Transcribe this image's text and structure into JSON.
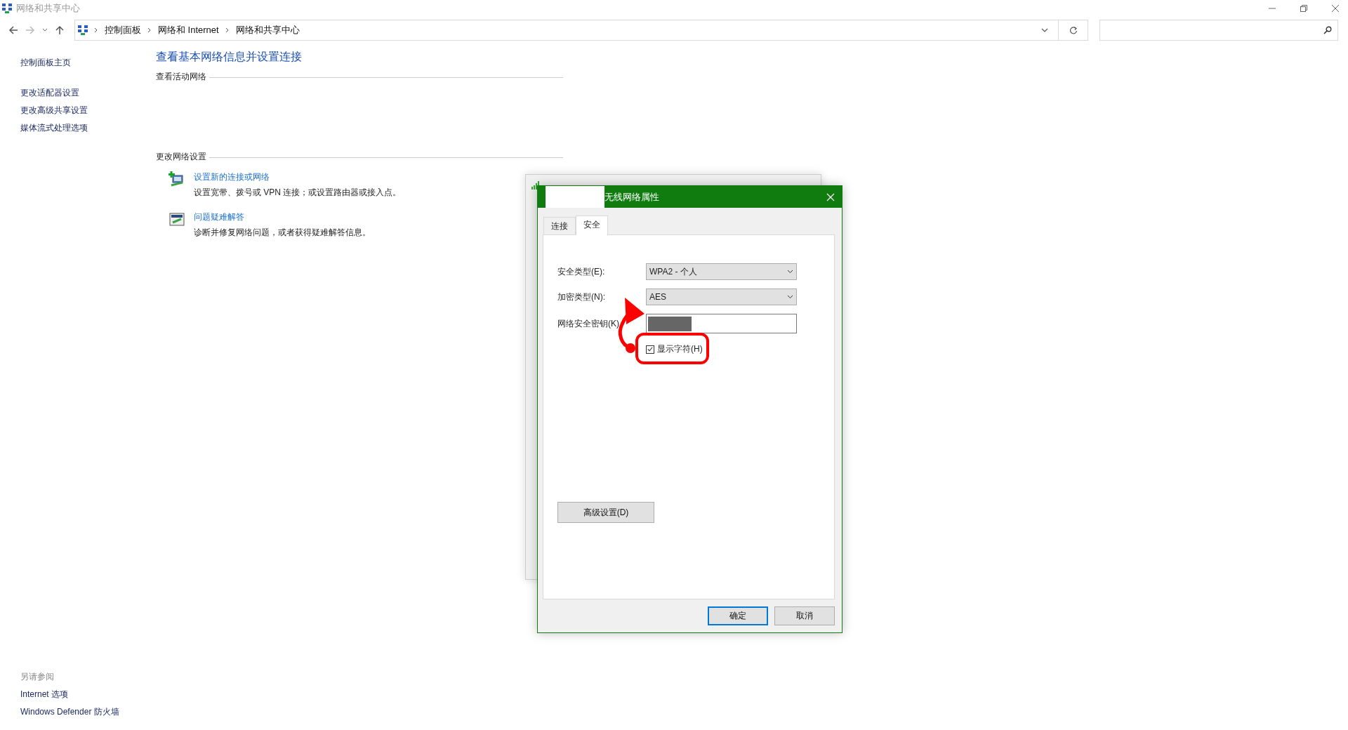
{
  "window": {
    "title": "网络和共享中心"
  },
  "address_bar": {
    "breadcrumbs": [
      "控制面板",
      "网络和 Internet",
      "网络和共享中心"
    ]
  },
  "sidebar": {
    "items": [
      "控制面板主页",
      "更改适配器设置",
      "更改高级共享设置",
      "媒体流式处理选项"
    ],
    "see_also": {
      "title": "另请参阅",
      "items": [
        "Internet 选项",
        "Windows Defender 防火墙"
      ]
    }
  },
  "main": {
    "heading": "查看基本网络信息并设置连接",
    "active_networks_title": "查看活动网络",
    "change_settings_title": "更改网络设置",
    "tasks": [
      {
        "kind": "new-connection",
        "title": "设置新的连接或网络",
        "description": "设置宽带、拨号或 VPN 连接；或设置路由器或接入点。"
      },
      {
        "kind": "troubleshoot",
        "title": "问题疑难解答",
        "description": "诊断并修复网络问题，或者获得疑难解答信息。"
      }
    ]
  },
  "dialog": {
    "title": "无线网络属性",
    "tabs": [
      {
        "label": "连接",
        "selected": false
      },
      {
        "label": "安全",
        "selected": true
      }
    ],
    "fields": [
      {
        "kind": "select",
        "label": "安全类型(E):",
        "value": "WPA2 - 个人"
      },
      {
        "kind": "select",
        "label": "加密类型(N):",
        "value": "AES"
      },
      {
        "kind": "password",
        "label": "网络安全密钥(K)"
      }
    ],
    "show_characters": {
      "label": "显示字符(H)",
      "checked": true
    },
    "advanced_button": "高级设置(D)",
    "buttons": [
      {
        "label": "确定",
        "default": true
      },
      {
        "label": "取消",
        "default": false
      }
    ]
  }
}
